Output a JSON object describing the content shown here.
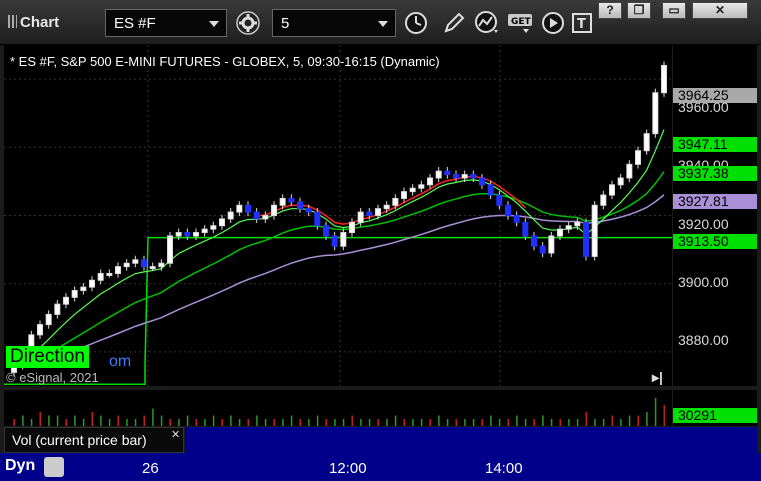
{
  "toolbar": {
    "app_title": "Chart",
    "symbol": "ES #F",
    "interval": "5",
    "window_controls": [
      "?",
      "❐",
      "▭",
      "✕"
    ]
  },
  "chart": {
    "header": "* ES #F, S&P 500 E-MINI FUTURES - GLOBEX, 5, 09:30-16:15 (Dynamic)",
    "y_ticks": [
      "3960.00",
      "3940.00",
      "3920.00",
      "3900.00",
      "3880.00"
    ],
    "price_tags": [
      {
        "label": "3964.25",
        "color": "#a9a9a9"
      },
      {
        "label": "3947.11",
        "color": "#00e000"
      },
      {
        "label": "3937.38",
        "color": "#00e000"
      },
      {
        "label": "3927.81",
        "color": "#a98fd6"
      },
      {
        "label": "3913.50",
        "color": "#00e000"
      }
    ],
    "direction_label": "Direction",
    "copyright": "© eSignal, 2021",
    "com_fragment": "om"
  },
  "volume": {
    "label": "Vol (current price bar)",
    "value": "30291",
    "close_glyph": "✕"
  },
  "time_axis": {
    "labels": [
      "26",
      "12:00",
      "14:00"
    ],
    "dyn": "Dyn"
  },
  "chart_data": {
    "type": "candlestick",
    "y_range": [
      3870,
      3970
    ],
    "closes": [
      3876,
      3880,
      3885,
      3888,
      3891,
      3894,
      3896,
      3898,
      3899,
      3901,
      3903,
      3903,
      3905,
      3906,
      3907,
      3905,
      3905,
      3906,
      3914,
      3915,
      3914,
      3915,
      3916,
      3917,
      3919,
      3921,
      3923,
      3921,
      3919,
      3920,
      3923,
      3925,
      3924,
      3922,
      3921,
      3917,
      3914,
      3911,
      3915,
      3918,
      3921,
      3920,
      3922,
      3923,
      3925,
      3927,
      3928,
      3929,
      3931,
      3933,
      3932,
      3931,
      3932,
      3931,
      3929,
      3926,
      3923,
      3920,
      3918,
      3914,
      3911,
      3909,
      3914,
      3916,
      3917,
      3918,
      3908,
      3923,
      3926,
      3929,
      3931,
      3935,
      3939,
      3944,
      3956,
      3964
    ],
    "lines": {
      "ema_fast": "green",
      "ema_slow": "lime",
      "avg": "purple",
      "signal": "red",
      "reference": 3913.5
    },
    "volume": [
      2,
      3,
      2,
      4,
      3,
      3,
      2,
      3,
      2,
      4,
      3,
      2,
      3,
      2,
      2,
      3,
      5,
      3,
      2,
      2,
      3,
      2,
      2,
      3,
      2,
      3,
      2,
      2,
      3,
      2,
      2,
      2,
      3,
      2,
      2,
      3,
      2,
      2,
      2,
      3,
      2,
      2,
      2,
      2,
      3,
      2,
      2,
      2,
      2,
      3,
      2,
      2,
      2,
      2,
      2,
      3,
      2,
      2,
      3,
      2,
      2,
      3,
      2,
      2,
      2,
      2,
      4,
      2,
      2,
      3,
      2,
      3,
      3,
      4,
      8,
      6
    ]
  }
}
